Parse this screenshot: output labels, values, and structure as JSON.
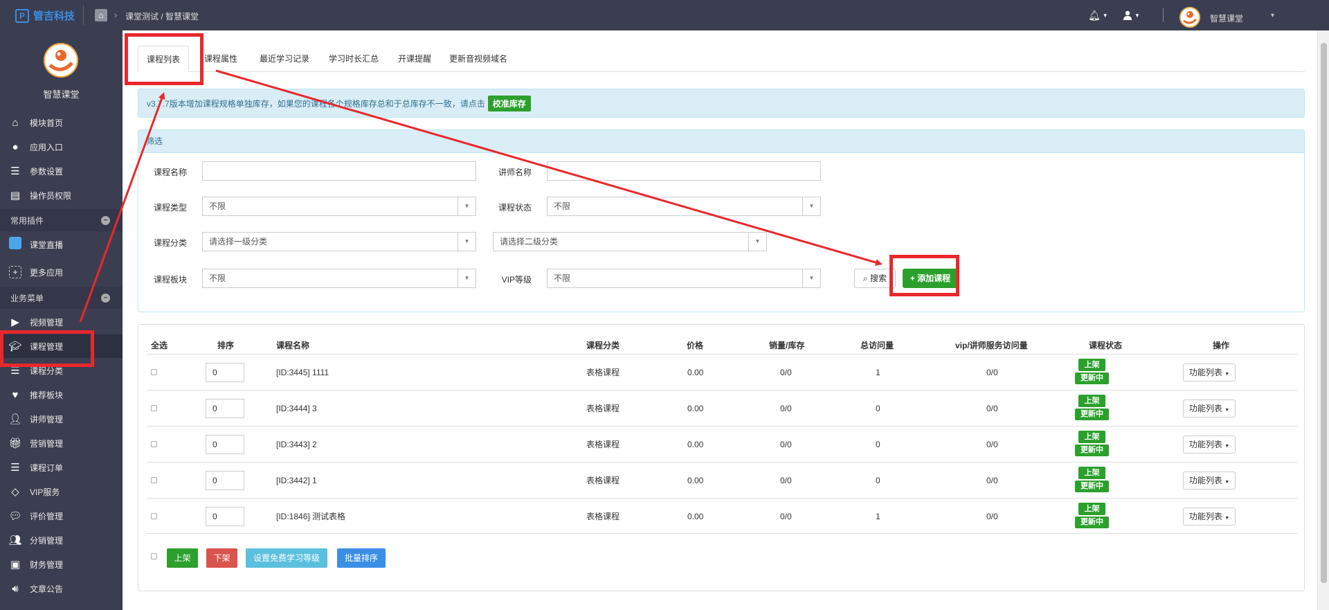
{
  "topbar": {
    "logo_text": "管吉科技",
    "breadcrumb": "课堂测试 / 智慧课堂",
    "username": "智慧课堂"
  },
  "sidebar": {
    "profile_name": "智慧课堂",
    "items_top": [
      {
        "label": "模块首页",
        "icon": "home-icon"
      },
      {
        "label": "应用入口",
        "icon": "chat-icon"
      },
      {
        "label": "参数设置",
        "icon": "list-icon"
      },
      {
        "label": "操作员权限",
        "icon": "document-icon"
      }
    ],
    "group_plugins": "常用插件",
    "items_plugins": [
      {
        "label": "课堂直播",
        "icon": "live-icon"
      },
      {
        "label": "更多应用",
        "icon": "plus-box-icon"
      }
    ],
    "group_business": "业务菜单",
    "items_business": [
      {
        "label": "视频管理",
        "icon": "play-icon"
      },
      {
        "label": "课程管理",
        "icon": "graduation-cap-icon"
      },
      {
        "label": "课程分类",
        "icon": "list-icon"
      },
      {
        "label": "推荐板块",
        "icon": "heart-icon"
      },
      {
        "label": "讲师管理",
        "icon": "teacher-icon"
      },
      {
        "label": "营销管理",
        "icon": "gift-icon"
      },
      {
        "label": "课程订单",
        "icon": "list-icon"
      },
      {
        "label": "VIP服务",
        "icon": "diamond-icon"
      },
      {
        "label": "评价管理",
        "icon": "comment-icon"
      },
      {
        "label": "分销管理",
        "icon": "users-icon"
      },
      {
        "label": "财务管理",
        "icon": "money-icon"
      },
      {
        "label": "文章公告",
        "icon": "speaker-icon"
      }
    ]
  },
  "tabs": [
    "课程列表",
    "课程属性",
    "最近学习记录",
    "学习时长汇总",
    "开课提醒",
    "更新音视频域名"
  ],
  "notice": {
    "text": "v3.7.7版本增加课程规格单独库存，如果您的课程各个规格库存总和于总库存不一致，请点击",
    "button": "校准库存"
  },
  "filter": {
    "title": "筛选",
    "course_name_label": "课程名称",
    "course_name_value": "",
    "teacher_name_label": "讲师名称",
    "teacher_name_value": "",
    "course_type_label": "课程类型",
    "course_type_value": "不限",
    "course_status_label": "课程状态",
    "course_status_value": "不限",
    "category_label": "课程分类",
    "category1_value": "请选择一级分类",
    "category2_value": "请选择二级分类",
    "block_label": "课程板块",
    "block_value": "不限",
    "vip_label": "VIP等级",
    "vip_value": "不限",
    "search_button": "搜索",
    "add_button": "添加课程"
  },
  "table": {
    "headers": [
      "全选",
      "排序",
      "课程名称",
      "课程分类",
      "价格",
      "销量/库存",
      "总访问量",
      "vip/讲师服务访问量",
      "课程状态",
      "操作"
    ],
    "rows": [
      {
        "sort": "0",
        "name": "[ID:3445] 1111",
        "category": "表格课程",
        "price": "0.00",
        "sales": "0/0",
        "visits": "1",
        "vip_visits": "0/0",
        "status": "上架",
        "sub_status": "更新中",
        "action": "功能列表"
      },
      {
        "sort": "0",
        "name": "[ID:3444] 3",
        "category": "表格课程",
        "price": "0.00",
        "sales": "0/0",
        "visits": "0",
        "vip_visits": "0/0",
        "status": "上架",
        "sub_status": "更新中",
        "action": "功能列表"
      },
      {
        "sort": "0",
        "name": "[ID:3443] 2",
        "category": "表格课程",
        "price": "0.00",
        "sales": "0/0",
        "visits": "0",
        "vip_visits": "0/0",
        "status": "上架",
        "sub_status": "更新中",
        "action": "功能列表"
      },
      {
        "sort": "0",
        "name": "[ID:3442] 1",
        "category": "表格课程",
        "price": "0.00",
        "sales": "0/0",
        "visits": "0",
        "vip_visits": "0/0",
        "status": "上架",
        "sub_status": "更新中",
        "action": "功能列表"
      },
      {
        "sort": "0",
        "name": "[ID:1846] 测试表格",
        "category": "表格课程",
        "price": "0.00",
        "sales": "0/0",
        "visits": "1",
        "vip_visits": "0/0",
        "status": "上架",
        "sub_status": "更新中",
        "action": "功能列表"
      }
    ],
    "bulk_actions": [
      "上架",
      "下架",
      "设置免费学习等级",
      "批量排序"
    ]
  },
  "colors": {
    "sidebar_bg": "#3b3e50",
    "accent_green": "#2ca02c",
    "accent_red": "#d9534f",
    "accent_info": "#5bc0de",
    "accent_primary": "#3a8ee6",
    "annotation_red": "#e8282c"
  }
}
